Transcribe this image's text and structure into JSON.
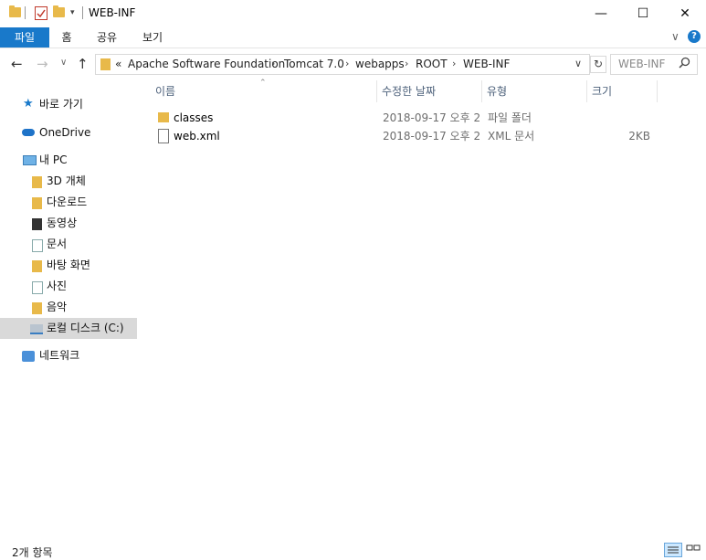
{
  "window": {
    "title": "WEB-INF",
    "controls": {
      "minimize": "—",
      "maximize": "☐",
      "close": "✕"
    }
  },
  "ribbon": {
    "tabs": [
      {
        "label": "파일"
      },
      {
        "label": "홈"
      },
      {
        "label": "공유"
      },
      {
        "label": "보기"
      }
    ]
  },
  "nav": {
    "breadcrumb_prefix": "«",
    "path": [
      "Apache Software Foundation",
      "Tomcat 7.0",
      "webapps",
      "ROOT",
      "WEB-INF"
    ],
    "search_placeholder": "WEB-INF"
  },
  "sidebar": {
    "items": [
      {
        "label": "바로 가기",
        "icon": "star-icon"
      },
      {
        "label": "OneDrive",
        "icon": "cloud-icon"
      },
      {
        "label": "내 PC",
        "icon": "computer-icon"
      },
      {
        "label": "3D 개체",
        "icon": "folder-3d-icon"
      },
      {
        "label": "다운로드",
        "icon": "folder-download-icon"
      },
      {
        "label": "동영상",
        "icon": "folder-video-icon"
      },
      {
        "label": "문서",
        "icon": "folder-documents-icon"
      },
      {
        "label": "바탕 화면",
        "icon": "folder-desktop-icon"
      },
      {
        "label": "사진",
        "icon": "folder-pictures-icon"
      },
      {
        "label": "음악",
        "icon": "folder-music-icon"
      },
      {
        "label": "로컬 디스크 (C:)",
        "icon": "drive-icon",
        "selected": true
      },
      {
        "label": "네트워크",
        "icon": "network-icon"
      }
    ]
  },
  "files": {
    "columns": {
      "name": "이름",
      "modified": "수정한 날짜",
      "type": "유형",
      "size": "크기"
    },
    "rows": [
      {
        "name": "classes",
        "modified": "2018-09-17 오후 2",
        "type": "파일 폴더",
        "size": "",
        "icon": "folder-icon"
      },
      {
        "name": "web.xml",
        "modified": "2018-09-17 오후 2",
        "type": "XML 문서",
        "size": "2KB",
        "icon": "file-icon"
      }
    ]
  },
  "status": {
    "item_count": "2개 항목"
  },
  "colors": {
    "accent": "#1979ca",
    "selected": "#d9d9d9",
    "folder": "#e8b94a"
  }
}
